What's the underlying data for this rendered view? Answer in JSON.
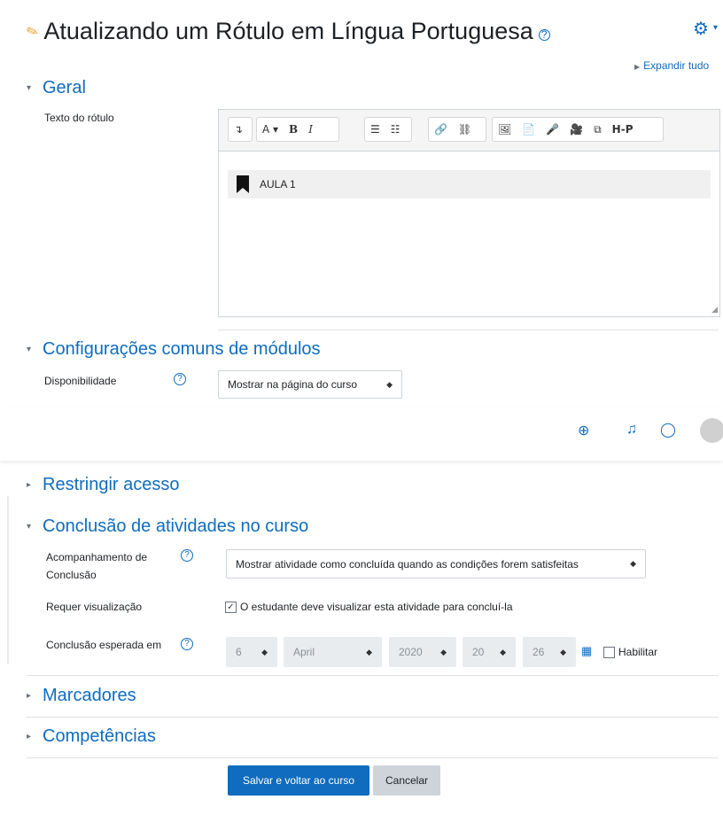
{
  "page": {
    "title": "Atualizando um Rótulo em Língua Portuguesa",
    "expand_all": "Expandir tudo"
  },
  "sections": {
    "geral": {
      "title": "Geral",
      "field_label": "Texto do rótulo",
      "editor_content": "AULA 1",
      "toolbar": [
        "↴",
        "A ▾",
        "B",
        "I",
        "☰",
        "☷",
        "🔗",
        "⛓",
        "🖼",
        "📄",
        "🎤",
        "🎥",
        "⧉",
        "H-P"
      ]
    },
    "modulos": {
      "title": "Configurações comuns de módulos",
      "availability_label": "Disponibilidade",
      "availability_value": "Mostrar na página do curso"
    },
    "restringir": {
      "title": "Restringir acesso"
    },
    "conclusao": {
      "title": "Conclusão de atividades no curso",
      "tracking_label_1": "Acompanhamento de",
      "tracking_label_2": "Conclusão",
      "tracking_value": "Mostrar atividade como concluída quando as condições forem satisfeitas",
      "view_label": "Requer visualização",
      "view_checkbox": "O estudante deve visualizar esta atividade para concluí-la",
      "view_checked": true,
      "expected_label": "Conclusão esperada em",
      "day": "6",
      "month": "April",
      "year": "2020",
      "hour": "20",
      "minute": "26",
      "enable_label": "Habilitar",
      "enable_checked": false
    },
    "marcadores": {
      "title": "Marcadores"
    },
    "competencias": {
      "title": "Competências"
    }
  },
  "buttons": {
    "save": "Salvar e voltar ao curso",
    "cancel": "Cancelar"
  },
  "colors": {
    "accent": "#0f6cbf"
  },
  "icons": [
    "pencil-icon",
    "gear-icon",
    "help-icon",
    "globe-icon",
    "bell-icon",
    "chat-icon",
    "calendar-icon",
    "bookmark-icon"
  ]
}
